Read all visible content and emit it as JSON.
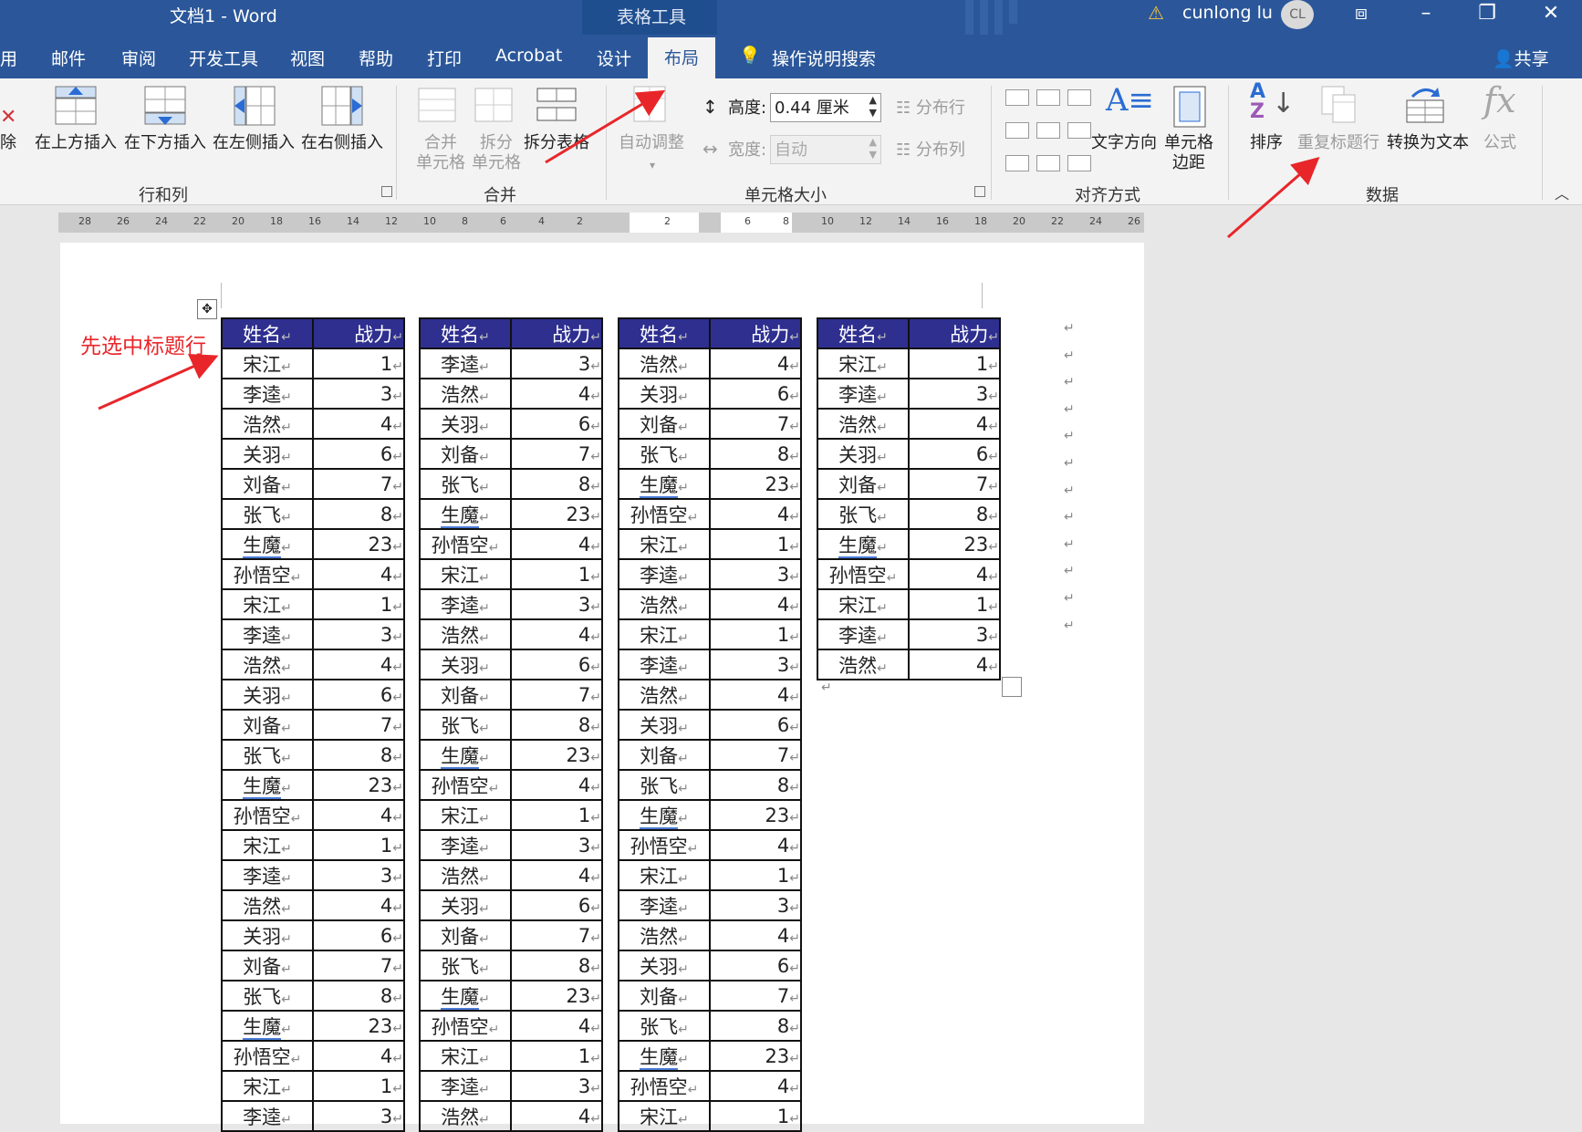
{
  "titlebar": {
    "doc_title": "文档1  -  Word",
    "context_title": "表格工具",
    "warning_icon": "warning-icon",
    "user_name": "cunlong lu",
    "avatar_initials": "CL"
  },
  "tabs": [
    "用",
    "邮件",
    "审阅",
    "开发工具",
    "视图",
    "帮助",
    "打印",
    "Acrobat",
    "设计",
    "布局"
  ],
  "active_tab": "布局",
  "tell_me": "操作说明搜索",
  "share": "共享",
  "ribbon": {
    "delete_label": "除",
    "rows_cols": {
      "group": "行和列",
      "insert_above": "在上方插入",
      "insert_below": "在下方插入",
      "insert_left": "在左侧插入",
      "insert_right": "在右侧插入"
    },
    "merge": {
      "group": "合并",
      "merge_cells_1": "合并",
      "merge_cells_2": "单元格",
      "split_cells_1": "拆分",
      "split_cells_2": "单元格",
      "split_table": "拆分表格"
    },
    "cell_size": {
      "group": "单元格大小",
      "autofit": "自动调整",
      "height_label": "高度:",
      "height_value": "0.44 厘米",
      "width_label": "宽度:",
      "width_value": "自动",
      "distribute_rows": "分布行",
      "distribute_cols": "分布列"
    },
    "alignment": {
      "group": "对齐方式",
      "text_direction": "文字方向",
      "cell_margins_1": "单元格",
      "cell_margins_2": "边距"
    },
    "data": {
      "group": "数据",
      "sort": "排序",
      "repeat_header": "重复标题行",
      "convert_text": "转换为文本",
      "formula": "公式"
    }
  },
  "ruler": {
    "left": [
      "28",
      "26",
      "24",
      "22",
      "20",
      "18",
      "16",
      "14",
      "12",
      "10",
      "8",
      "6",
      "4",
      "2"
    ],
    "center": "2",
    "right": [
      "6",
      "8",
      "10",
      "12",
      "14",
      "16",
      "18",
      "20",
      "22",
      "24",
      "26"
    ]
  },
  "annotation": "先选中标题行",
  "header": {
    "name": "姓名",
    "power": "战力"
  },
  "cell_mark": "↵",
  "columns": [
    [
      [
        "宋江",
        "1"
      ],
      [
        "李逵",
        "3"
      ],
      [
        "浩然",
        "4"
      ],
      [
        "关羽",
        "6"
      ],
      [
        "刘备",
        "7"
      ],
      [
        "张飞",
        "8"
      ],
      [
        "生魔",
        "23"
      ],
      [
        "孙悟空",
        "4"
      ],
      [
        "宋江",
        "1"
      ],
      [
        "李逵",
        "3"
      ],
      [
        "浩然",
        "4"
      ],
      [
        "关羽",
        "6"
      ],
      [
        "刘备",
        "7"
      ],
      [
        "张飞",
        "8"
      ],
      [
        "生魔",
        "23"
      ],
      [
        "孙悟空",
        "4"
      ],
      [
        "宋江",
        "1"
      ],
      [
        "李逵",
        "3"
      ],
      [
        "浩然",
        "4"
      ],
      [
        "关羽",
        "6"
      ],
      [
        "刘备",
        "7"
      ],
      [
        "张飞",
        "8"
      ],
      [
        "生魔",
        "23"
      ],
      [
        "孙悟空",
        "4"
      ],
      [
        "宋江",
        "1"
      ],
      [
        "李逵",
        "3"
      ]
    ],
    [
      [
        "李逵",
        "3"
      ],
      [
        "浩然",
        "4"
      ],
      [
        "关羽",
        "6"
      ],
      [
        "刘备",
        "7"
      ],
      [
        "张飞",
        "8"
      ],
      [
        "生魔",
        "23"
      ],
      [
        "孙悟空",
        "4"
      ],
      [
        "宋江",
        "1"
      ],
      [
        "李逵",
        "3"
      ],
      [
        "浩然",
        "4"
      ],
      [
        "关羽",
        "6"
      ],
      [
        "刘备",
        "7"
      ],
      [
        "张飞",
        "8"
      ],
      [
        "生魔",
        "23"
      ],
      [
        "孙悟空",
        "4"
      ],
      [
        "宋江",
        "1"
      ],
      [
        "李逵",
        "3"
      ],
      [
        "浩然",
        "4"
      ],
      [
        "关羽",
        "6"
      ],
      [
        "刘备",
        "7"
      ],
      [
        "张飞",
        "8"
      ],
      [
        "生魔",
        "23"
      ],
      [
        "孙悟空",
        "4"
      ],
      [
        "宋江",
        "1"
      ],
      [
        "李逵",
        "3"
      ],
      [
        "浩然",
        "4"
      ]
    ],
    [
      [
        "浩然",
        "4"
      ],
      [
        "关羽",
        "6"
      ],
      [
        "刘备",
        "7"
      ],
      [
        "张飞",
        "8"
      ],
      [
        "生魔",
        "23"
      ],
      [
        "孙悟空",
        "4"
      ],
      [
        "宋江",
        "1"
      ],
      [
        "李逵",
        "3"
      ],
      [
        "浩然",
        "4"
      ],
      [
        "宋江",
        "1"
      ],
      [
        "李逵",
        "3"
      ],
      [
        "浩然",
        "4"
      ],
      [
        "关羽",
        "6"
      ],
      [
        "刘备",
        "7"
      ],
      [
        "张飞",
        "8"
      ],
      [
        "生魔",
        "23"
      ],
      [
        "孙悟空",
        "4"
      ],
      [
        "宋江",
        "1"
      ],
      [
        "李逵",
        "3"
      ],
      [
        "浩然",
        "4"
      ],
      [
        "关羽",
        "6"
      ],
      [
        "刘备",
        "7"
      ],
      [
        "张飞",
        "8"
      ],
      [
        "生魔",
        "23"
      ],
      [
        "孙悟空",
        "4"
      ],
      [
        "宋江",
        "1"
      ]
    ],
    [
      [
        "宋江",
        "1"
      ],
      [
        "李逵",
        "3"
      ],
      [
        "浩然",
        "4"
      ],
      [
        "关羽",
        "6"
      ],
      [
        "刘备",
        "7"
      ],
      [
        "张飞",
        "8"
      ],
      [
        "生魔",
        "23"
      ],
      [
        "孙悟空",
        "4"
      ],
      [
        "宋江",
        "1"
      ],
      [
        "李逵",
        "3"
      ],
      [
        "浩然",
        "4"
      ]
    ]
  ],
  "colors": {
    "accent": "#2b579a",
    "header_fill": "#2e2f8f",
    "annotation": "#e8262a"
  }
}
